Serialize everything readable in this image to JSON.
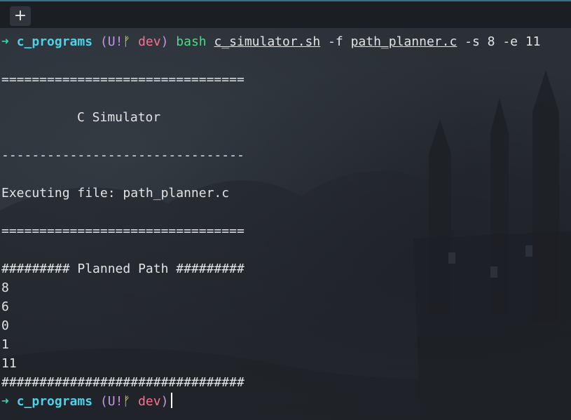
{
  "tabbar": {
    "new_tab_label": "+"
  },
  "prompt": {
    "arrow": "➜",
    "directory": "c_programs",
    "git_open": "(U!",
    "git_icon": "ᚠ",
    "branch": "dev",
    "git_close": ")"
  },
  "command": {
    "name": "bash",
    "script": "c_simulator.sh",
    "flag_f": "-f",
    "file": "path_planner.c",
    "rest": "-s 8 -e 11"
  },
  "output": {
    "rule_top": "================================",
    "title": "C Simulator",
    "rule_mid": "--------------------------------",
    "executing": "Executing file: path_planner.c",
    "rule_bottom": "================================",
    "path_header": "######### Planned Path #########",
    "path": [
      "8",
      "6",
      "0",
      "1",
      "11"
    ],
    "rule_end": "################################"
  },
  "colors": {
    "prompt_arrow": "#35d6a7",
    "directory": "#4fd1e8",
    "git_paren": "#c792ea",
    "branch": "#ff6f91",
    "command": "#56d68a",
    "text": "#e3e3e3"
  }
}
